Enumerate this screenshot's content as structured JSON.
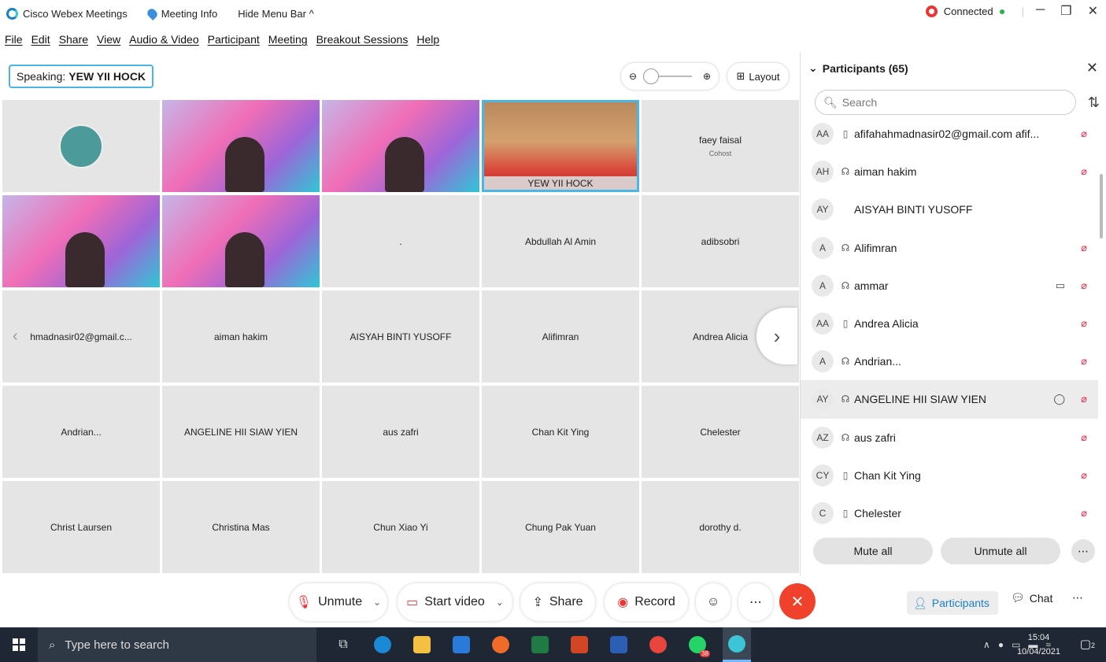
{
  "titlebar": {
    "app_name": "Cisco Webex Meetings",
    "meeting_info": "Meeting Info",
    "hide_menu": "Hide Menu Bar ^",
    "status": "Connected"
  },
  "menu": [
    "File",
    "Edit",
    "Share",
    "View",
    "Audio & Video",
    "Participant",
    "Meeting",
    "Breakout Sessions",
    "Help"
  ],
  "stage": {
    "speaking_label": "Speaking:",
    "speaking_name": "YEW YII HOCK",
    "layout_label": "Layout",
    "tiles": [
      {
        "name": "",
        "sub": "",
        "kind": "avatar"
      },
      {
        "name": "",
        "sub": "",
        "kind": "video"
      },
      {
        "name": "",
        "sub": "",
        "kind": "video"
      },
      {
        "name": "YEW YII HOCK",
        "sub": "",
        "kind": "live"
      },
      {
        "name": "faey faisal",
        "sub": "Cohost",
        "kind": "name"
      },
      {
        "name": "",
        "sub": "",
        "kind": "video"
      },
      {
        "name": "",
        "sub": "",
        "kind": "video"
      },
      {
        "name": ".",
        "sub": "",
        "kind": "name"
      },
      {
        "name": "Abdullah Al Amin",
        "sub": "",
        "kind": "name"
      },
      {
        "name": "adibsobri",
        "sub": "",
        "kind": "name"
      },
      {
        "name": "hmadnasir02@gmail.c...",
        "sub": "",
        "kind": "name"
      },
      {
        "name": "aiman hakim",
        "sub": "",
        "kind": "name"
      },
      {
        "name": "AISYAH BINTI YUSOFF",
        "sub": "",
        "kind": "name"
      },
      {
        "name": "Alifimran",
        "sub": "",
        "kind": "name"
      },
      {
        "name": "Andrea Alicia",
        "sub": "",
        "kind": "name"
      },
      {
        "name": "Andrian...",
        "sub": "",
        "kind": "name"
      },
      {
        "name": "ANGELINE HII SIAW YIEN",
        "sub": "",
        "kind": "name"
      },
      {
        "name": "aus zafri",
        "sub": "",
        "kind": "name"
      },
      {
        "name": "Chan Kit Ying",
        "sub": "",
        "kind": "name"
      },
      {
        "name": "Chelester",
        "sub": "",
        "kind": "name"
      },
      {
        "name": "Christ Laursen",
        "sub": "",
        "kind": "name"
      },
      {
        "name": "Christina Mas",
        "sub": "",
        "kind": "name"
      },
      {
        "name": "Chun Xiao Yi",
        "sub": "",
        "kind": "name"
      },
      {
        "name": "Chung Pak Yuan",
        "sub": "",
        "kind": "name"
      },
      {
        "name": "dorothy d.",
        "sub": "",
        "kind": "name"
      }
    ]
  },
  "participants": {
    "title": "Participants (65)",
    "search_placeholder": "Search",
    "list": [
      {
        "initials": "AA",
        "name": "afifahahmadnasir02@gmail.com afif...",
        "device": "phone",
        "video": false,
        "chat": false
      },
      {
        "initials": "AH",
        "name": "aiman hakim",
        "device": "audio",
        "video": false,
        "chat": false
      },
      {
        "initials": "AY",
        "name": "AISYAH BINTI YUSOFF",
        "device": "none",
        "video": false,
        "chat": false
      },
      {
        "initials": "A",
        "name": "Alifimran",
        "device": "audio",
        "video": false,
        "chat": false
      },
      {
        "initials": "A",
        "name": "ammar",
        "device": "audio",
        "video": true,
        "chat": false
      },
      {
        "initials": "AA",
        "name": "Andrea Alicia",
        "device": "phone",
        "video": false,
        "chat": false
      },
      {
        "initials": "A",
        "name": "Andrian...",
        "device": "audio",
        "video": false,
        "chat": false
      },
      {
        "initials": "AY",
        "name": "ANGELINE HII SIAW YIEN",
        "device": "audio",
        "video": false,
        "chat": true
      },
      {
        "initials": "AZ",
        "name": "aus zafri",
        "device": "audio",
        "video": false,
        "chat": false
      },
      {
        "initials": "CY",
        "name": "Chan Kit Ying",
        "device": "phone",
        "video": false,
        "chat": false
      },
      {
        "initials": "C",
        "name": "Chelester",
        "device": "phone",
        "video": false,
        "chat": false
      }
    ],
    "mute_all": "Mute all",
    "unmute_all": "Unmute all"
  },
  "controls": {
    "unmute": "Unmute",
    "start_video": "Start video",
    "share": "Share",
    "record": "Record",
    "participants_tab": "Participants",
    "chat_tab": "Chat"
  },
  "taskbar": {
    "search_placeholder": "Type here to search",
    "time": "15:04",
    "date": "10/04/2021",
    "whatsapp_badge": "38",
    "notification_badge": "2"
  },
  "colors": {
    "accent": "#49b6e6",
    "end_call": "#f0412c",
    "taskbar": "#1e2733",
    "mute_red": "#e22244"
  }
}
